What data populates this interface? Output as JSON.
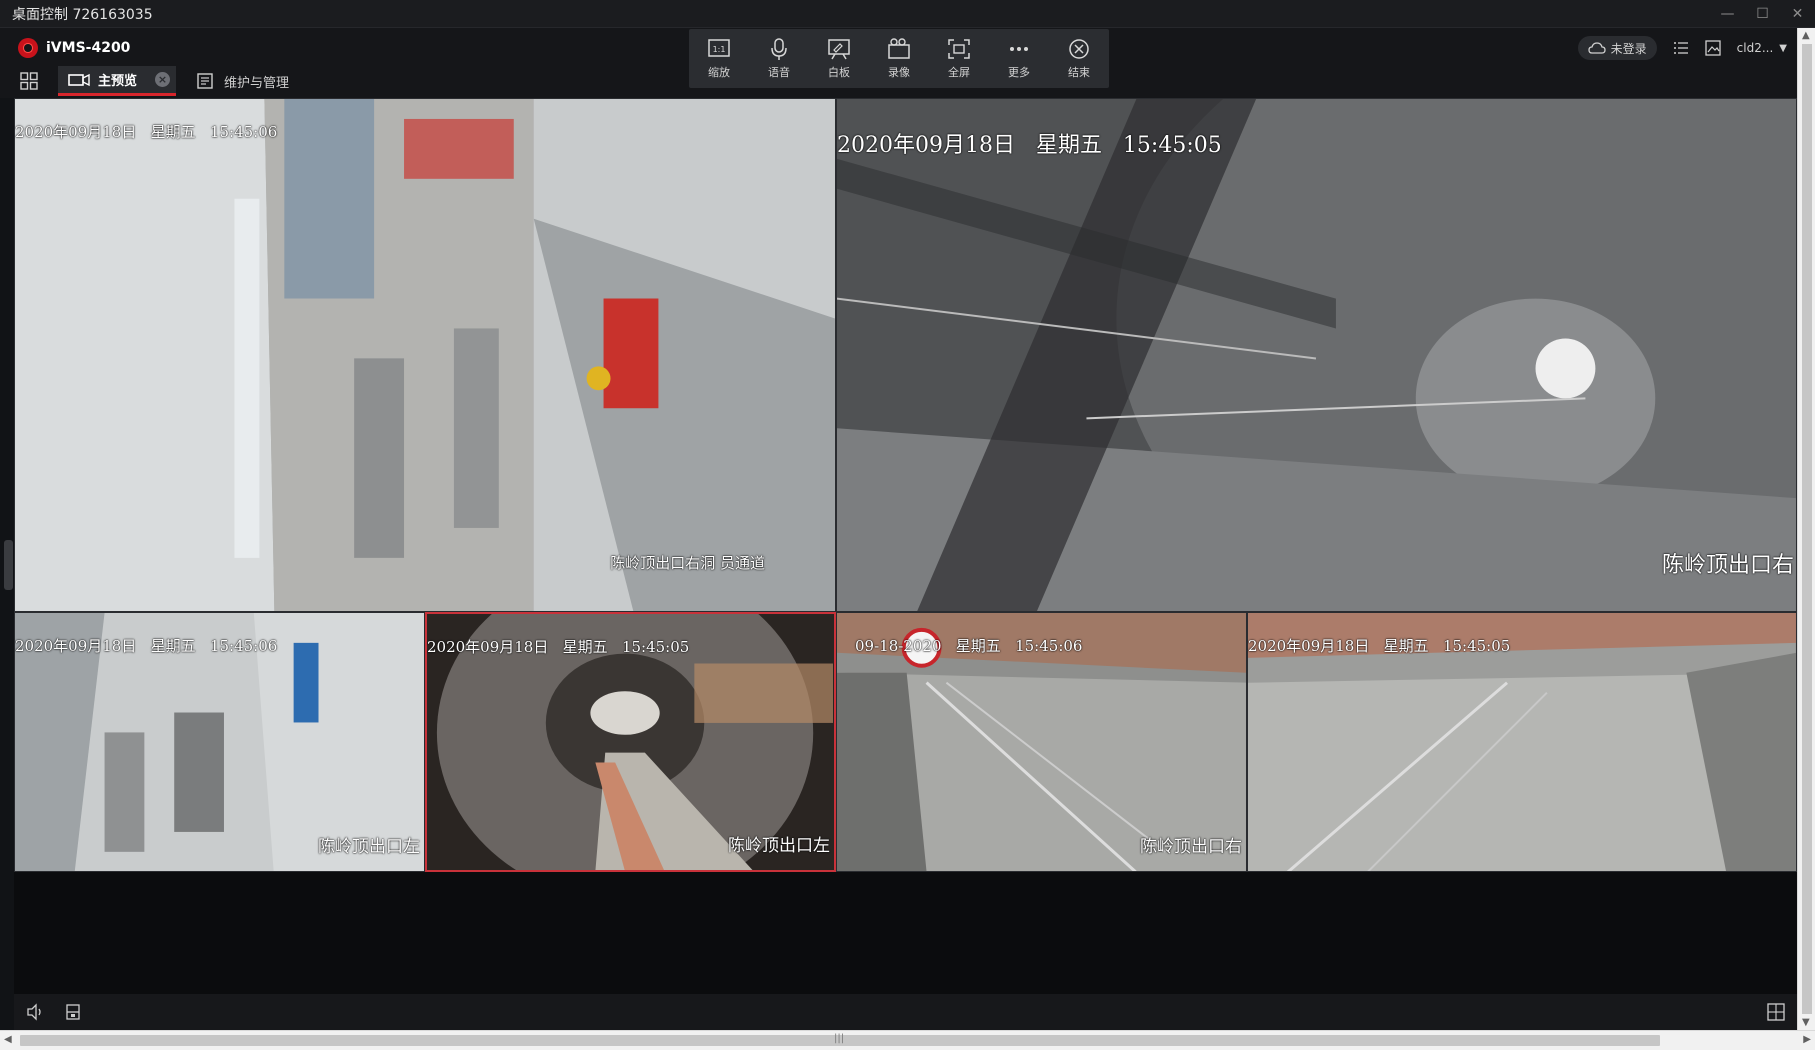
{
  "window": {
    "title": "桌面控制 726163035",
    "controls": [
      "—",
      "☐",
      "✕"
    ]
  },
  "app": {
    "name": "iVMS-4200"
  },
  "tabs": [
    {
      "label": "主预览",
      "active": true
    },
    {
      "label": "维护与管理",
      "active": false
    }
  ],
  "toolbar": {
    "items": [
      {
        "label": "缩放",
        "icon": "zoom-1to1-icon"
      },
      {
        "label": "语音",
        "icon": "microphone-icon"
      },
      {
        "label": "白板",
        "icon": "whiteboard-icon"
      },
      {
        "label": "录像",
        "icon": "record-camera-icon"
      },
      {
        "label": "全屏",
        "icon": "fullscreen-icon"
      },
      {
        "label": "更多",
        "icon": "more-dots-icon"
      },
      {
        "label": "结束",
        "icon": "close-circle-icon"
      }
    ]
  },
  "header_right": {
    "login_status": "未登录",
    "user": "cld2..."
  },
  "video_panes": [
    {
      "timestamp": "2020年09月18日   星期五   15:45:06",
      "channel": "陈岭顶出口右洞 员通道",
      "selected": false
    },
    {
      "timestamp": "2020年09月18日   星期五   15:45:05",
      "channel": "陈岭顶出口右",
      "selected": false
    },
    {
      "timestamp": "2020年09月18日   星期五   15:45:06",
      "channel": "陈岭顶出口左",
      "selected": false
    },
    {
      "timestamp": "2020年09月18日   星期五   15:45:05",
      "channel": "陈岭顶出口左",
      "selected": true
    },
    {
      "timestamp": "09-18-2020   星期五   15:45:06",
      "channel": "陈岭顶出口右",
      "selected": false
    },
    {
      "timestamp": "2020年09月18日   星期五   15:45:05",
      "channel": "",
      "selected": false
    }
  ],
  "colors": {
    "accent": "#d9262c",
    "background": "#111316",
    "toolbar": "#2b2d31"
  }
}
